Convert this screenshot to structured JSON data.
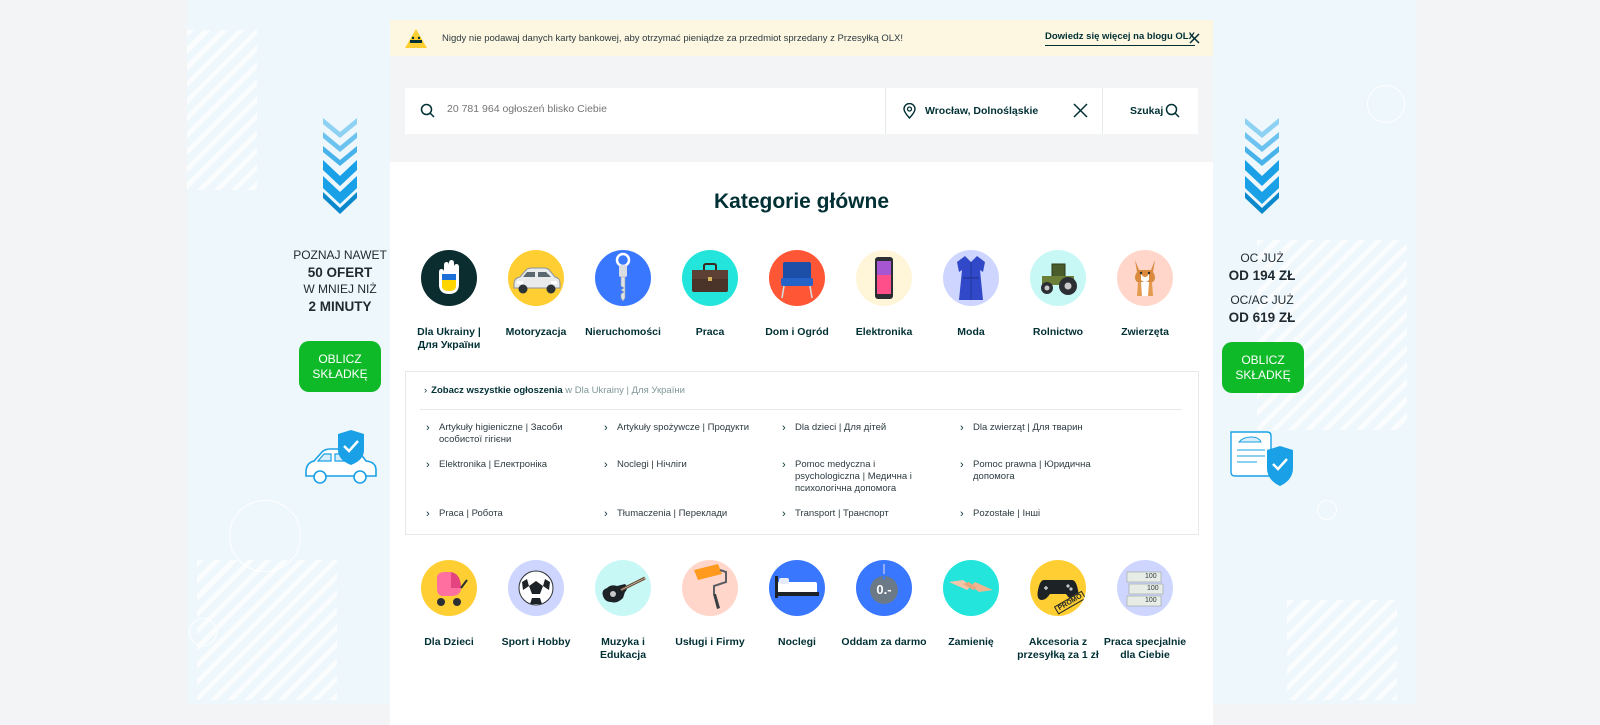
{
  "notice": {
    "message": "Nigdy nie podawaj danych karty bankowej, aby otrzymać pieniądze za przedmiot sprzedany z Przesyłką OLX!",
    "link": "Dowiedz się więcej na blogu OLX"
  },
  "search": {
    "placeholder": "20 781 964 ogłoszeń blisko Ciebie",
    "location": "Wrocław, Dolnośląskie",
    "button": "Szukaj"
  },
  "title": "Kategorie główne",
  "categories_top": [
    {
      "name": "Dla Ukrainy | Для України",
      "icon": "ukraine-hand-icon"
    },
    {
      "name": "Motoryzacja",
      "icon": "car-icon"
    },
    {
      "name": "Nieruchomości",
      "icon": "key-icon"
    },
    {
      "name": "Praca",
      "icon": "briefcase-icon"
    },
    {
      "name": "Dom i Ogród",
      "icon": "armchair-icon"
    },
    {
      "name": "Elektronika",
      "icon": "smartphone-icon"
    },
    {
      "name": "Moda",
      "icon": "dress-icon"
    },
    {
      "name": "Rolnictwo",
      "icon": "tractor-icon"
    },
    {
      "name": "Zwierzęta",
      "icon": "dog-icon"
    }
  ],
  "subpanel": {
    "all_label": "Zobacz wszystkie ogłoszenia",
    "all_in": "w Dla Ukrainy | Для України",
    "items": [
      "Artykuły higieniczne | Засоби особистої гігієни",
      "Artykuły spożywcze | Продукти",
      "Dla dzieci | Для дітей",
      "Dla zwierząt | Для тварин",
      "Elektronika | Електроніка",
      "Noclegi | Нічліги",
      "Pomoc medyczna i psychologiczna | Медична і психологічна допомога",
      "Pomoc prawna | Юридична допомога",
      "Praca | Робота",
      "Tłumaczenia | Переклади",
      "Transport | Транспорт",
      "Pozostałe | Інші"
    ]
  },
  "categories_bottom": [
    {
      "name": "Dla Dzieci",
      "icon": "stroller-icon"
    },
    {
      "name": "Sport i Hobby",
      "icon": "football-icon"
    },
    {
      "name": "Muzyka i Edukacja",
      "icon": "guitar-icon"
    },
    {
      "name": "Usługi i Firmy",
      "icon": "paint-roller-icon"
    },
    {
      "name": "Noclegi",
      "icon": "bed-icon"
    },
    {
      "name": "Oddam za darmo",
      "icon": "free-tag-icon",
      "tag": "0.-"
    },
    {
      "name": "Zamienię",
      "icon": "handshake-icon"
    },
    {
      "name": "Akcesoria z przesyłką za 1 zł",
      "icon": "gamepad-icon",
      "badge": "PROMO"
    },
    {
      "name": "Praca specjalnie dla Ciebie",
      "icon": "money-stack-icon",
      "notes": [
        "100",
        "100",
        "100"
      ]
    }
  ],
  "ad_left": {
    "line1": "POZNAJ NAWET",
    "line2": "50 OFERT",
    "line3": "W MNIEJ NIŻ",
    "line4": "2 MINUTY",
    "button": "OBLICZ SKŁADKĘ"
  },
  "ad_right": {
    "line1": "OC JUŻ",
    "line2": "OD 194 ZŁ",
    "line3": "OC/AC JUŻ",
    "line4": "OD 619 ZŁ",
    "button": "OBLICZ SKŁADKĘ"
  },
  "colors": {
    "brand_dark": "#002f34",
    "ad_green": "#0fba28",
    "ad_blue": "#1aa0e6",
    "notice_bg": "#fdf7e1",
    "page_bg": "#f2f4f5"
  }
}
